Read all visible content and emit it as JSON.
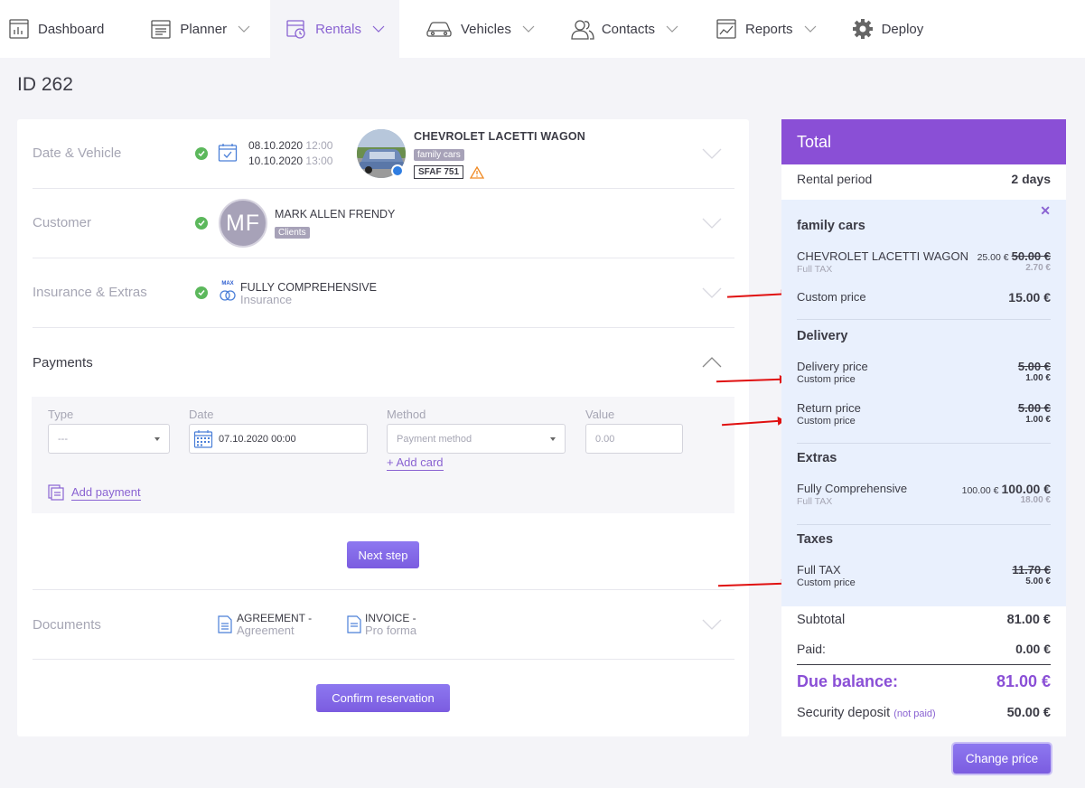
{
  "nav": {
    "items": [
      {
        "label": "Dashboard",
        "icon": "dashboard-icon",
        "active": false,
        "chevron": false
      },
      {
        "label": "Planner",
        "icon": "planner-icon",
        "active": false,
        "chevron": true
      },
      {
        "label": "Rentals",
        "icon": "rentals-icon",
        "active": true,
        "chevron": true
      },
      {
        "label": "Vehicles",
        "icon": "car-icon",
        "active": false,
        "chevron": true
      },
      {
        "label": "Contacts",
        "icon": "contacts-icon",
        "active": false,
        "chevron": true
      },
      {
        "label": "Reports",
        "icon": "reports-icon",
        "active": false,
        "chevron": true
      },
      {
        "label": "Deploy",
        "icon": "gear-icon",
        "active": false,
        "chevron": false
      }
    ]
  },
  "page": {
    "title": "ID 262"
  },
  "sections": {
    "date_vehicle": {
      "label": "Date & Vehicle",
      "start_date": "08.10.2020",
      "start_time": "12:00",
      "end_date": "10.10.2020",
      "end_time": "13:00",
      "vehicle_name": "CHEVROLET LACETTI WAGON",
      "vehicle_group": "family cars",
      "plate": "SFAF 751"
    },
    "customer": {
      "label": "Customer",
      "initials": "MF",
      "name": "MARK ALLEN FRENDY",
      "tag": "Clients"
    },
    "insurance": {
      "label": "Insurance & Extras",
      "badge": "MAX",
      "title": "FULLY COMPREHENSIVE",
      "subtitle": "Insurance"
    },
    "payments": {
      "label": "Payments",
      "type_label": "Type",
      "type_value": "---",
      "date_label": "Date",
      "date_value": "07.10.2020 00:00",
      "method_label": "Method",
      "method_placeholder": "Payment method",
      "value_label": "Value",
      "value_placeholder": "0.00",
      "add_card": "+ Add card",
      "add_payment": "Add payment",
      "next_step": "Next step"
    },
    "documents": {
      "label": "Documents",
      "doc1_title": "AGREEMENT -",
      "doc1_sub": "Agreement",
      "doc2_title": "INVOICE -",
      "doc2_sub": "Pro forma"
    },
    "confirm": "Confirm reservation"
  },
  "total": {
    "title": "Total",
    "rental_period_label": "Rental period",
    "rental_period_value": "2 days",
    "group_title": "family cars",
    "vehicle_line": "CHEVROLET LACETTI WAGON",
    "vehicle_small_price": "25.00 €",
    "vehicle_old_price": "50.00 €",
    "vehicle_tax_label": "Full TAX",
    "vehicle_tax_value": "2.70 €",
    "custom_price_label": "Custom price",
    "custom_price_value": "15.00 €",
    "delivery_title": "Delivery",
    "delivery_price_label": "Delivery price",
    "delivery_price_old": "5.00 €",
    "delivery_custom_label": "Custom price",
    "delivery_custom_value": "1.00 €",
    "return_price_label": "Return price",
    "return_price_old": "5.00 €",
    "return_custom_label": "Custom price",
    "return_custom_value": "1.00 €",
    "extras_title": "Extras",
    "extras_line": "Fully Comprehensive",
    "extras_small_price": "100.00 €",
    "extras_price": "100.00 €",
    "extras_tax_label": "Full TAX",
    "extras_tax_value": "18.00 €",
    "taxes_title": "Taxes",
    "taxes_line": "Full TAX",
    "taxes_old": "11.70 €",
    "taxes_custom_label": "Custom price",
    "taxes_custom_value": "5.00 €",
    "subtotal_label": "Subtotal",
    "subtotal_value": "81.00 €",
    "paid_label": "Paid:",
    "paid_value": "0.00 €",
    "due_label": "Due balance:",
    "due_value": "81.00 €",
    "deposit_label": "Security deposit",
    "deposit_status": "(not paid)",
    "deposit_value": "50.00 €",
    "change_price": "Change price"
  },
  "colors": {
    "accent": "#8a4fd6",
    "check": "#5cb85c",
    "warning": "#f08a24",
    "arrow": "#e01010"
  }
}
